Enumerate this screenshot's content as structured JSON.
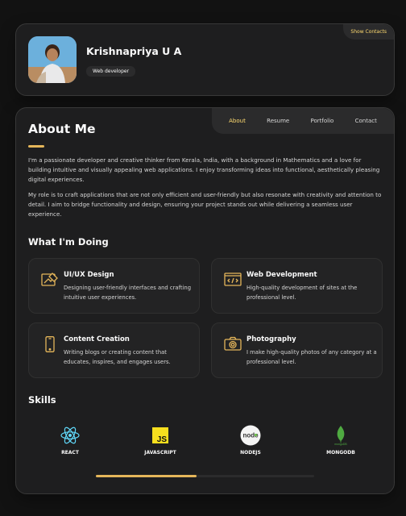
{
  "profile": {
    "name": "Krishnapriya U A",
    "role": "Web developer",
    "show_contacts": "Show Contacts"
  },
  "navbar": {
    "items": [
      "About",
      "Resume",
      "Portfolio",
      "Contact"
    ],
    "active": "About"
  },
  "about": {
    "title": "About Me",
    "paragraphs": [
      "I'm a passionate developer and creative thinker from Kerala, India, with a background in Mathematics and a love for building intuitive and visually appealing web applications. I enjoy transforming ideas into functional, aesthetically pleasing digital experiences.",
      "My role is to craft applications that are not only efficient and user-friendly but also resonate with creativity and attention to detail. I aim to bridge functionality and design, ensuring your project stands out while delivering a seamless user experience."
    ]
  },
  "doing": {
    "title": "What I'm Doing",
    "services": [
      {
        "title": "UI/UX Design",
        "text": "Designing user-friendly interfaces and crafting intuitive user experiences.",
        "icon": "design-icon"
      },
      {
        "title": "Web Development",
        "text": "High-quality development of sites at the professional level.",
        "icon": "code-icon"
      },
      {
        "title": "Content Creation",
        "text": "Writing blogs or creating content that educates, inspires, and engages users.",
        "icon": "mobile-icon"
      },
      {
        "title": "Photography",
        "text": "I make high-quality photos of any category at a professional level.",
        "icon": "camera-icon"
      }
    ]
  },
  "skills": {
    "title": "Skills",
    "items": [
      {
        "label": "REACT",
        "icon": "react-icon"
      },
      {
        "label": "JAVASCRIPT",
        "icon": "javascript-icon",
        "logo_text": "JS"
      },
      {
        "label": "NODEJS",
        "icon": "nodejs-icon",
        "logo_text": "node"
      },
      {
        "label": "MONGODB",
        "icon": "mongodb-icon",
        "logo_text": "mongoDB"
      }
    ],
    "scroll_progress": 0.46
  },
  "colors": {
    "accent": "#ffdb70",
    "gold": "#e5b65a",
    "background": "#121212",
    "card": "#1e1e1f"
  }
}
